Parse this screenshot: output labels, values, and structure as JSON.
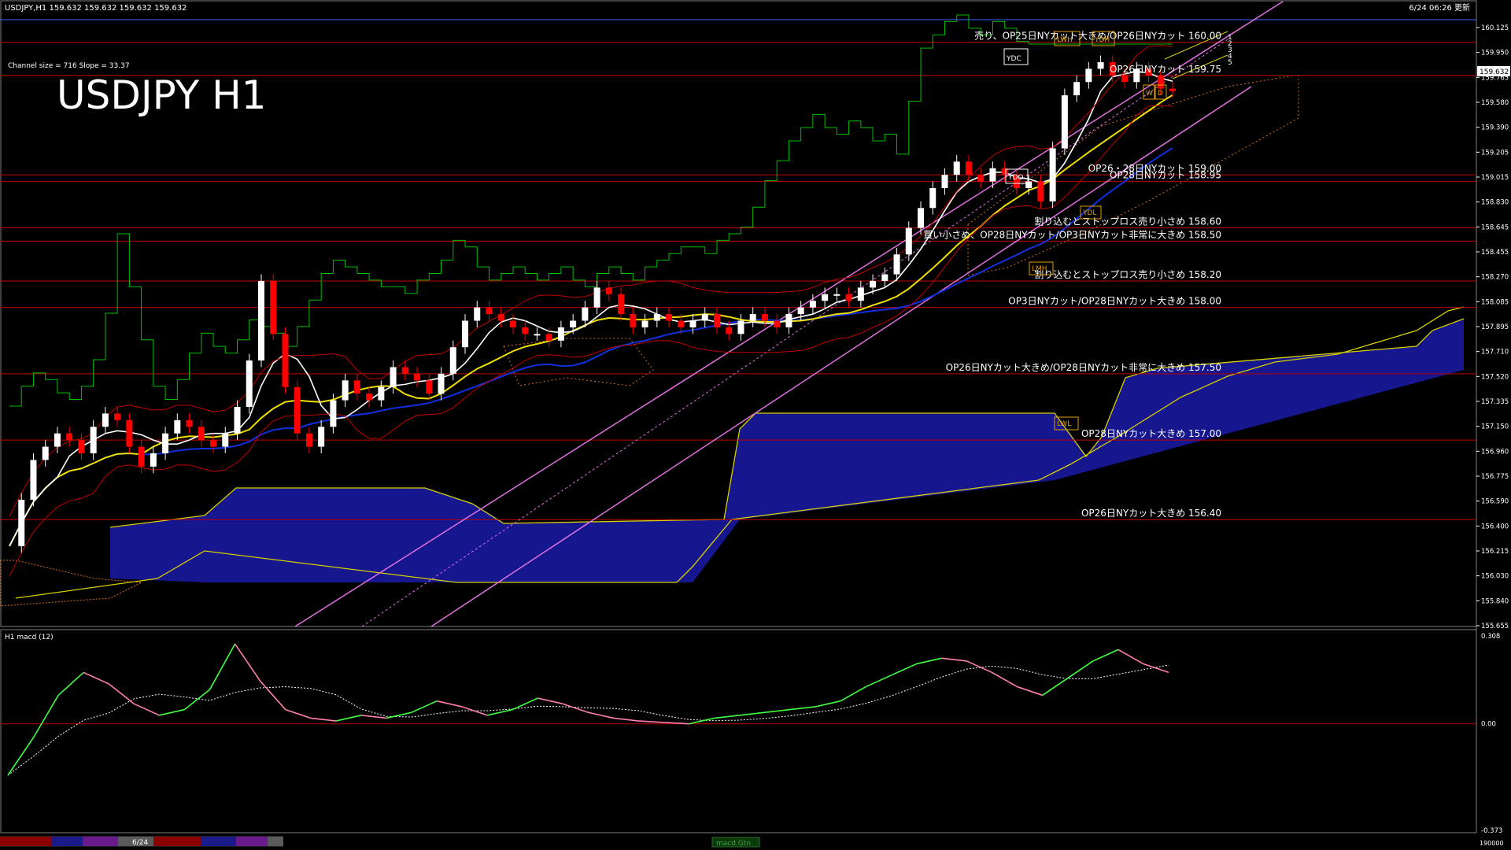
{
  "header": {
    "symbol_line": "USDJPY,H1  159.632 159.632 159.632 159.632",
    "timestamp": "6/24 06:26 更新",
    "chart_title": "USDJPY H1",
    "channel_info": "Channel size = 716 Slope = 33.37"
  },
  "price_axis": {
    "ticks": [
      "160.125",
      "159.950",
      "159.765",
      "159.580",
      "159.390",
      "159.205",
      "159.015",
      "158.830",
      "158.645",
      "158.455",
      "158.270",
      "158.085",
      "157.895",
      "157.710",
      "157.520",
      "157.335",
      "157.150",
      "156.960",
      "156.775",
      "156.590",
      "156.400",
      "156.215",
      "156.030",
      "155.840",
      "155.655"
    ],
    "current_price": "159.632"
  },
  "option_levels": [
    {
      "price": 160.0,
      "text": "売り、OP25日NYカット大きめ/OP26日NYカット 160.00"
    },
    {
      "price": 159.75,
      "text": "OP26日NYカット 159.75"
    },
    {
      "price": 159.0,
      "text": "OP26・28日NYカット 159.00"
    },
    {
      "price": 158.95,
      "text": "OP28日NYカット 158.95"
    },
    {
      "price": 158.6,
      "text": "割り込むとストップロス売り小さめ 158.60"
    },
    {
      "price": 158.5,
      "text": "買い小さめ、OP28日NYカット/OP3日NYカット非常に大きめ 158.50"
    },
    {
      "price": 158.2,
      "text": "割り込むとストップロス売り小さめ 158.20"
    },
    {
      "price": 158.0,
      "text": "OP3日NYカット/OP28日NYカット大きめ 158.00"
    },
    {
      "price": 157.5,
      "text": "OP26日NYカット大きめ/OP28日NYカット非常に大きめ 157.50"
    },
    {
      "price": 157.0,
      "text": "OP28日NYカット大きめ 157.00"
    },
    {
      "price": 156.4,
      "text": "OP26日NYカット大きめ 156.40"
    }
  ],
  "box_labels": [
    "YDC",
    "YDO",
    "LWH",
    "YDH",
    "YDL",
    "LMH",
    "LWL",
    "W",
    "D"
  ],
  "channel_numbers": [
    "1",
    "2",
    "3",
    "4",
    "5"
  ],
  "macd": {
    "label": "H1  macd (12)",
    "ticks": [
      "0.308",
      "0.00",
      "-0.373"
    ]
  },
  "bottom_bar": {
    "date_label": "6/24",
    "macd_tab": "macd Gtn",
    "right_value": "190000"
  },
  "colors": {
    "bull": "#ffffff",
    "bear": "#ff0000",
    "cloud_blue": "#1a1aa8",
    "cloud_orange": "#d4701a",
    "green_line": "#00c000",
    "yellow_ma": "#f0e000",
    "blue_ma": "#1030e0",
    "channel": "#e070e0",
    "level_line": "#c00000"
  },
  "chart_data": {
    "type": "candlestick",
    "title": "USDJPY H1",
    "ylim": [
      155.6,
      160.2
    ],
    "close_series": [
      156.2,
      156.55,
      156.85,
      156.95,
      157.05,
      157.0,
      156.9,
      157.1,
      157.2,
      157.15,
      156.95,
      156.8,
      156.9,
      157.05,
      157.15,
      157.1,
      157.0,
      156.95,
      157.05,
      157.25,
      157.6,
      158.2,
      157.8,
      157.4,
      157.05,
      156.95,
      157.1,
      157.3,
      157.45,
      157.35,
      157.3,
      157.4,
      157.55,
      157.5,
      157.45,
      157.35,
      157.5,
      157.7,
      157.9,
      158.0,
      157.95,
      157.9,
      157.85,
      157.8,
      157.8,
      157.75,
      157.85,
      157.9,
      158.0,
      158.15,
      158.1,
      157.95,
      157.85,
      157.9,
      157.95,
      157.9,
      157.85,
      157.9,
      157.95,
      157.85,
      157.8,
      157.9,
      157.95,
      157.9,
      157.85,
      157.95,
      158.0,
      158.05,
      158.1,
      158.1,
      158.05,
      158.15,
      158.2,
      158.25,
      158.4,
      158.6,
      158.75,
      158.9,
      159.0,
      159.1,
      159.0,
      158.95,
      159.05,
      159.0,
      158.9,
      158.95,
      158.8,
      159.2,
      159.6,
      159.7,
      159.8,
      159.85,
      159.75,
      159.7,
      159.8,
      159.75,
      159.65,
      159.63
    ],
    "series": [
      {
        "name": "macd",
        "values": [
          -0.18,
          -0.05,
          0.1,
          0.18,
          0.14,
          0.07,
          0.03,
          0.05,
          0.12,
          0.28,
          0.15,
          0.05,
          0.02,
          0.01,
          0.03,
          0.02,
          0.04,
          0.08,
          0.06,
          0.03,
          0.05,
          0.09,
          0.07,
          0.04,
          0.02,
          0.01,
          0.005,
          0.0,
          0.02,
          0.03,
          0.04,
          0.05,
          0.06,
          0.08,
          0.13,
          0.17,
          0.21,
          0.23,
          0.22,
          0.18,
          0.13,
          0.1,
          0.16,
          0.22,
          0.26,
          0.21,
          0.18
        ]
      }
    ],
    "macd_ylim": [
      -0.373,
      0.308
    ]
  }
}
